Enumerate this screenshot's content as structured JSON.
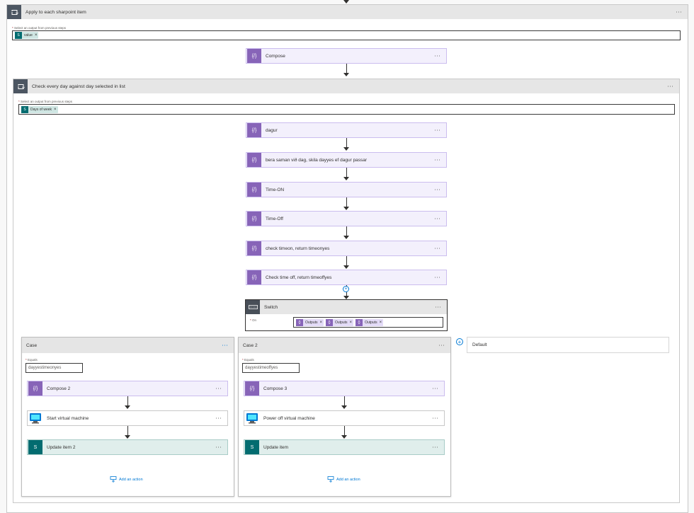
{
  "apply_each": {
    "title": "Apply to each sharpoint item",
    "field_label": "Select an output from previous steps",
    "token": "value",
    "more": "···"
  },
  "compose": {
    "title": "Compose",
    "more": "···"
  },
  "check_loop": {
    "title": "Check every day against day selected in list",
    "field_label": "Select an output from previous steps",
    "token": "Days of week",
    "more": "···"
  },
  "actions": [
    {
      "title": "dagur"
    },
    {
      "title": "bera saman við dag, skila dayyes ef dagur passar"
    },
    {
      "title": "Time-ON"
    },
    {
      "title": "Time-Off"
    },
    {
      "title": "check timeon, return timeonyes"
    },
    {
      "title": "Check time off, return timeoffyes"
    }
  ],
  "switch": {
    "title": "Switch",
    "on_label": "On",
    "tokens": [
      "Outputs",
      "Outputs",
      "Outputs"
    ],
    "more": "···"
  },
  "cases": [
    {
      "title": "Case",
      "equals_label": "Equals",
      "equals_value": "dayyestimeonyes",
      "steps": [
        "Compose 2",
        "Start virtual machine",
        "Update item 2"
      ],
      "add_action": "Add an action"
    },
    {
      "title": "Case 2",
      "equals_label": "Equals",
      "equals_value": "dayyestimeoffyes",
      "steps": [
        "Compose 3",
        "Power off virtual machine",
        "Update item"
      ],
      "add_action": "Add an action"
    }
  ],
  "default": {
    "title": "Default"
  },
  "colors": {
    "compose": "#8764b8",
    "sharepoint": "#036c70",
    "azure": "#0078d4",
    "loop": "#4c5662"
  },
  "icons": {
    "loop": "loop-icon",
    "compose": "compose-icon",
    "switch": "switch-icon",
    "azure_vm": "azure-vm-icon",
    "sharepoint": "sharepoint-icon"
  }
}
